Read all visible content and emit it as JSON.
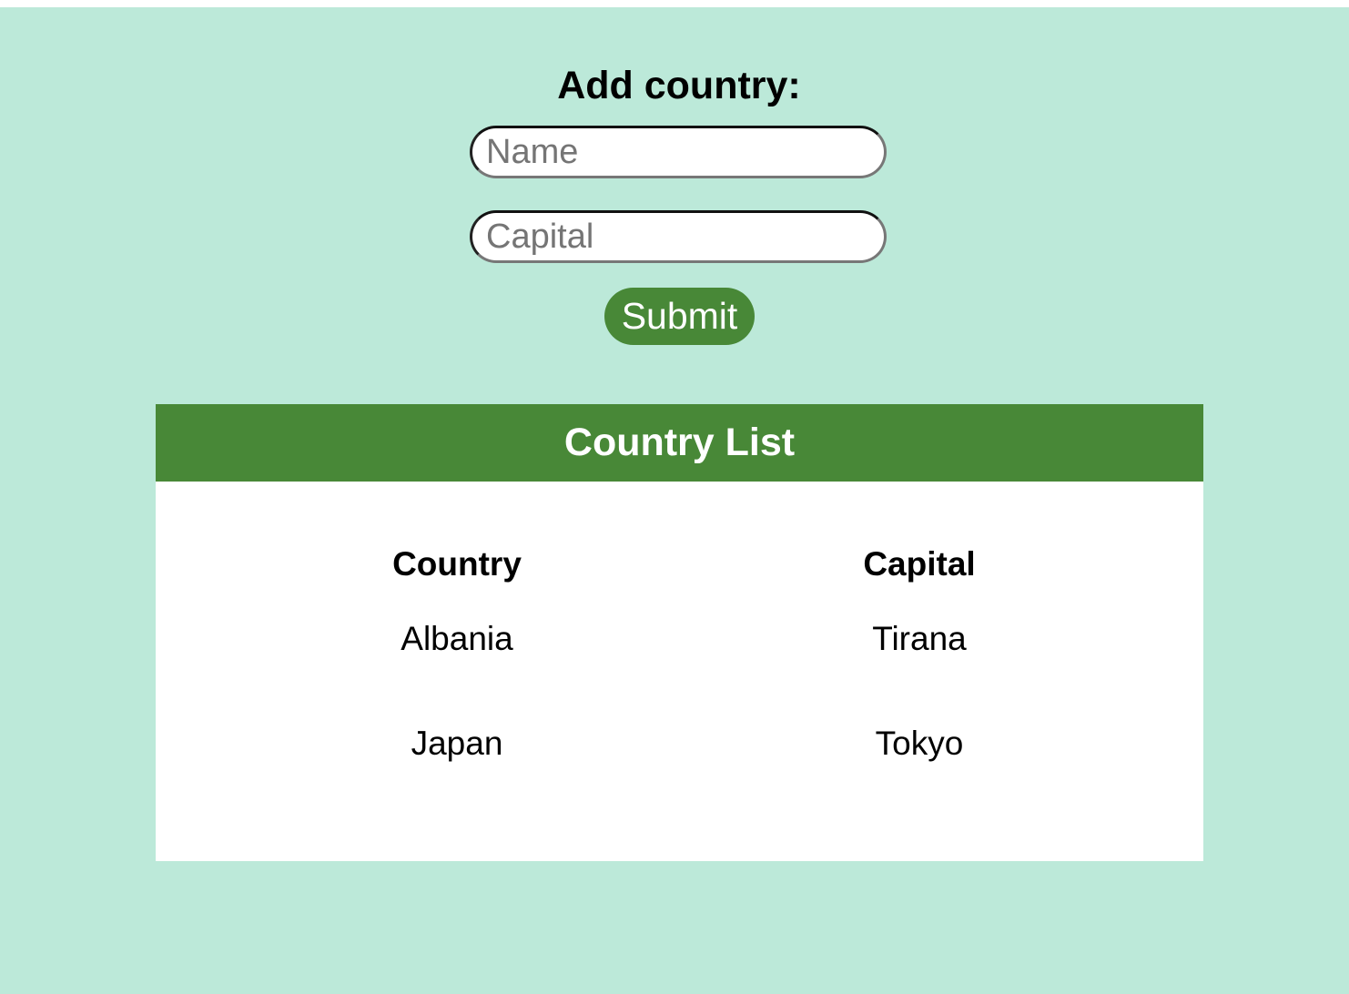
{
  "form": {
    "title": "Add country:",
    "name_placeholder": "Name",
    "capital_placeholder": "Capital",
    "name_value": "",
    "capital_value": "",
    "submit_label": "Submit"
  },
  "list": {
    "title": "Country List",
    "headers": [
      "Country",
      "Capital"
    ],
    "rows": [
      [
        "Albania",
        "Tirana"
      ],
      [
        "Japan",
        "Tokyo"
      ]
    ]
  },
  "colors": {
    "background": "#bce9d9",
    "accent": "#488837",
    "card": "#ffffff"
  }
}
